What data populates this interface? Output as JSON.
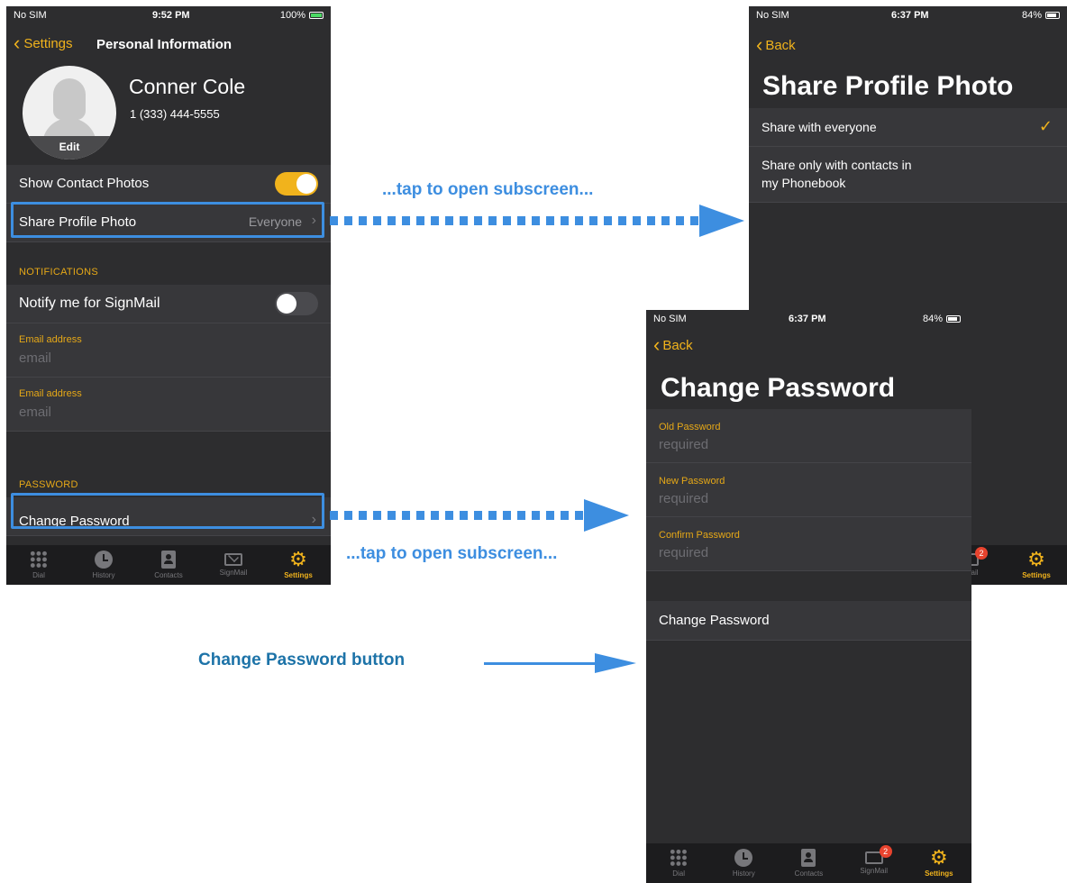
{
  "phone1": {
    "status": {
      "carrier": "No SIM",
      "time": "9:52 PM",
      "battery": "100%"
    },
    "nav": {
      "back_label": "Settings",
      "title": "Personal Information"
    },
    "profile": {
      "name": "Conner Cole",
      "phone": "1 (333) 444-5555",
      "edit_label": "Edit"
    },
    "rows": {
      "show_contact_photos": "Show Contact Photos",
      "share_profile_photo": "Share Profile Photo",
      "share_profile_photo_value": "Everyone"
    },
    "notifications": {
      "header": "NOTIFICATIONS",
      "notify_label": "Notify me for SignMail",
      "email1_label": "Email address",
      "email1_placeholder": "email",
      "email2_label": "Email address",
      "email2_placeholder": "email"
    },
    "password": {
      "header": "PASSWORD",
      "change_label": "Change Password"
    },
    "tabs": [
      "Dial",
      "History",
      "Contacts",
      "SignMail",
      "Settings"
    ]
  },
  "phone2": {
    "status": {
      "carrier": "No SIM",
      "time": "6:37 PM",
      "battery": "84%"
    },
    "back_label": "Back",
    "title": "Share Profile Photo",
    "options": [
      "Share with everyone",
      "Share only with contacts in",
      "my Phonebook"
    ],
    "tabs_visible": [
      "nMail",
      "Settings"
    ],
    "badge": "2"
  },
  "phone3": {
    "status": {
      "carrier": "No SIM",
      "time": "6:37 PM",
      "battery": "84%"
    },
    "back_label": "Back",
    "title": "Change Password",
    "fields": [
      {
        "label": "Old Password",
        "placeholder": "required"
      },
      {
        "label": "New Password",
        "placeholder": "required"
      },
      {
        "label": "Confirm Password",
        "placeholder": "required"
      }
    ],
    "button_label": "Change Password",
    "tabs": [
      "Dial",
      "History",
      "Contacts",
      "SignMail",
      "Settings"
    ],
    "badge": "2"
  },
  "callouts": {
    "tap_top": "...tap to open subscreen...",
    "tap_bottom": "...tap to open subscreen...",
    "button": "Change Password button"
  },
  "colors": {
    "accent": "#f1b31c",
    "callout": "#3d8ee0",
    "background": "#2d2d2f"
  }
}
